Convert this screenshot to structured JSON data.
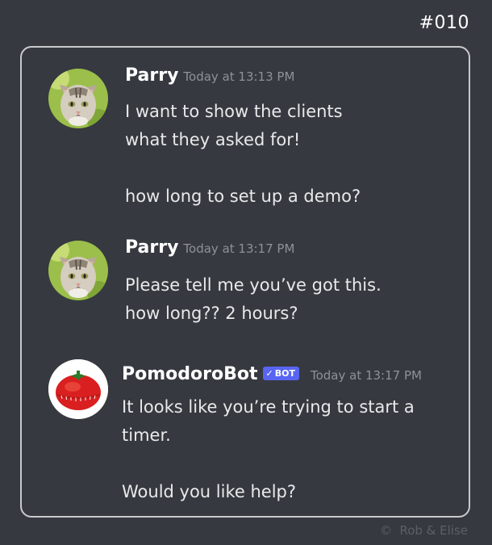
{
  "strip": {
    "number": "#010"
  },
  "messages": [
    {
      "username": "Parry",
      "timestamp": "Today at 13:13 PM",
      "avatar_icon": "cat-avatar-icon",
      "lines": [
        "I want to show the clients",
        "what they asked for!",
        "",
        "how long to set up a demo?"
      ]
    },
    {
      "username": "Parry",
      "timestamp": "Today at 13:17 PM",
      "avatar_icon": "cat-avatar-icon",
      "lines": [
        "Please tell me you’ve got this.",
        "how long?? 2 hours?"
      ]
    },
    {
      "username": "PomodoroBot",
      "bot_tag": "BOT",
      "bot_check": "✓",
      "timestamp": "Today at 13:17 PM",
      "avatar_icon": "tomato-timer-icon",
      "lines": [
        "It looks like you’re trying to start a",
        "timer.",
        "",
        "Would you like help?"
      ]
    }
  ],
  "footer": {
    "copyright_symbol": "©",
    "credit": "Rob & Elise"
  },
  "colors": {
    "background": "#36393f",
    "bot_tag": "#5865f2",
    "username": "#ffffff",
    "timestamp": "#8e9297"
  }
}
